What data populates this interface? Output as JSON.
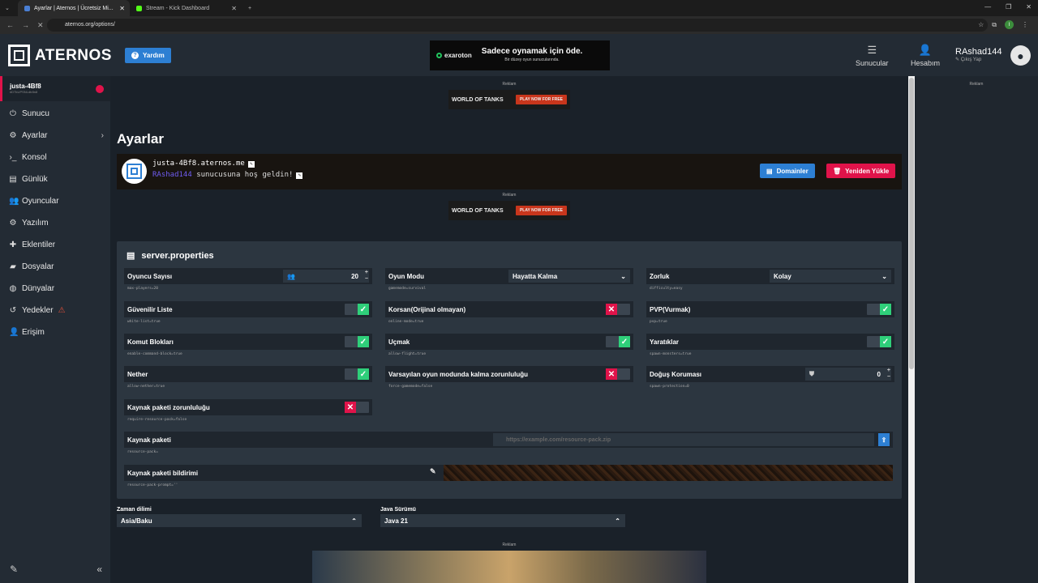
{
  "browser": {
    "tabs": [
      {
        "title": "Ayarlar | Aternos | Ücretsiz Mi...",
        "active": true
      },
      {
        "title": "Stream - Kick Dashboard",
        "active": false
      }
    ],
    "url": "aternos.org/options/",
    "profile_initial": "I"
  },
  "header": {
    "logo_text": "ATERNOS",
    "help_label": "Yardım",
    "ad": {
      "brand": "exaroton",
      "headline": "Sadece oynamak için öde.",
      "sub": "Bir düzey oyun sunucularında."
    },
    "nav_servers": "Sunucular",
    "nav_account": "Hesabım",
    "username": "RAshad144",
    "logout": "Çıkış Yap"
  },
  "sidebar": {
    "server_name": "justa-4Bf8",
    "server_id": "#DTkUPSNLdtr8n8",
    "items": [
      {
        "label": "Sunucu",
        "icon": "power-icon"
      },
      {
        "label": "Ayarlar",
        "icon": "sliders-icon"
      },
      {
        "label": "Konsol",
        "icon": "terminal-icon"
      },
      {
        "label": "Günlük",
        "icon": "file-icon"
      },
      {
        "label": "Oyuncular",
        "icon": "users-icon"
      },
      {
        "label": "Yazılım",
        "icon": "gears-icon"
      },
      {
        "label": "Eklentiler",
        "icon": "puzzle-icon"
      },
      {
        "label": "Dosyalar",
        "icon": "folder-icon"
      },
      {
        "label": "Dünyalar",
        "icon": "globe-icon"
      },
      {
        "label": "Yedekler",
        "icon": "history-icon"
      },
      {
        "label": "Erişim",
        "icon": "user-lock-icon"
      }
    ]
  },
  "main": {
    "ad_label": "Reklam",
    "ad_wot": "WORLD OF TANKS",
    "ad_play": "PLAY NOW FOR FREE",
    "title": "Ayarlar",
    "motd": {
      "address": "justa-4Bf8.aternos.me",
      "player": "RAshad144",
      "message": " sunucusuna hoş geldin!",
      "domains_btn": "Domainler",
      "reload_btn": "Yeniden Yükle"
    },
    "props_title": "server.properties",
    "props": {
      "max_players": {
        "label": "Oyuncu Sayısı",
        "value": "20",
        "key": "max-players=20"
      },
      "gamemode": {
        "label": "Oyun Modu",
        "value": "Hayatta Kalma",
        "key": "gamemode=survival"
      },
      "difficulty": {
        "label": "Zorluk",
        "value": "Kolay",
        "key": "difficulty=easy"
      },
      "whitelist": {
        "label": "Güvenilir Liste",
        "key": "white-list=true",
        "on": true
      },
      "online_mode": {
        "label": "Korsan(Orijinal olmayan)",
        "key": "online-mode=true",
        "on": false
      },
      "pvp": {
        "label": "PVP(Vurmak)",
        "key": "pvp=true",
        "on": true
      },
      "command_block": {
        "label": "Komut Blokları",
        "key": "enable-command-block=true",
        "on": true
      },
      "flight": {
        "label": "Uçmak",
        "key": "allow-flight=true",
        "on": true
      },
      "monsters": {
        "label": "Yaratıklar",
        "key": "spawn-monsters=true",
        "on": true
      },
      "nether": {
        "label": "Nether",
        "key": "allow-nether=true",
        "on": true
      },
      "force_gamemode": {
        "label": "Varsayılan oyun modunda kalma zorunluluğu",
        "key": "force-gamemode=false",
        "on": false
      },
      "spawn_protection": {
        "label": "Doğuş Koruması",
        "value": "0",
        "key": "spawn-protection=0"
      },
      "require_rp": {
        "label": "Kaynak paketi zorunluluğu",
        "key": "require-resource-pack=false",
        "on": false
      },
      "resource_pack": {
        "label": "Kaynak paketi",
        "key": "resource-pack=",
        "placeholder": "https://example.com/resource-pack.zip"
      },
      "rp_prompt": {
        "label": "Kaynak paketi bildirimi",
        "key": "resource-pack-prompt=''"
      }
    },
    "timezone": {
      "label": "Zaman dilimi",
      "value": "Asia/Baku"
    },
    "java": {
      "label": "Java Sürümü",
      "value": "Java 21"
    }
  },
  "rightbar": {
    "ad_label": "Reklam"
  }
}
